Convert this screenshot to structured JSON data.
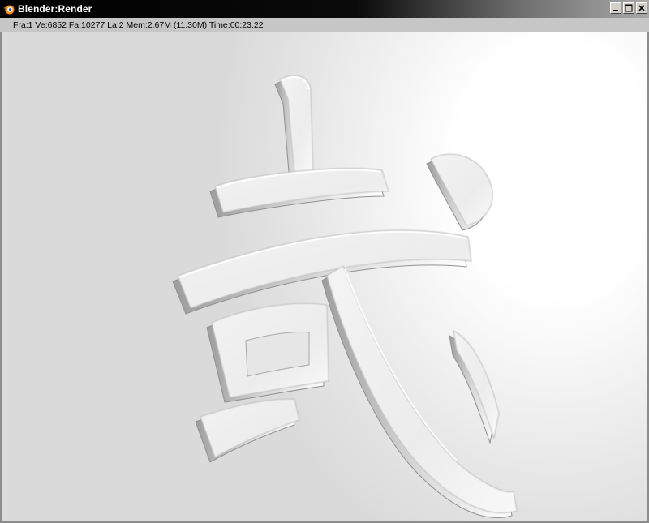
{
  "window": {
    "title": "Blender:Render",
    "icon": "blender-logo-icon",
    "controls": [
      "minimize-icon",
      "maximize-icon",
      "close-icon"
    ]
  },
  "status": {
    "text": "Fra:1  Ve:6852 Fa:10277 La:2 Mem:2.67M (11.30M) Time:00:23.22"
  },
  "render": {
    "subject": "3D extruded kanji character",
    "glyph": "武"
  },
  "colors": {
    "titlebar": "#000000",
    "statusbar": "#c6c6c6",
    "background": "#e3e3e3",
    "glyph": "#efefef"
  }
}
